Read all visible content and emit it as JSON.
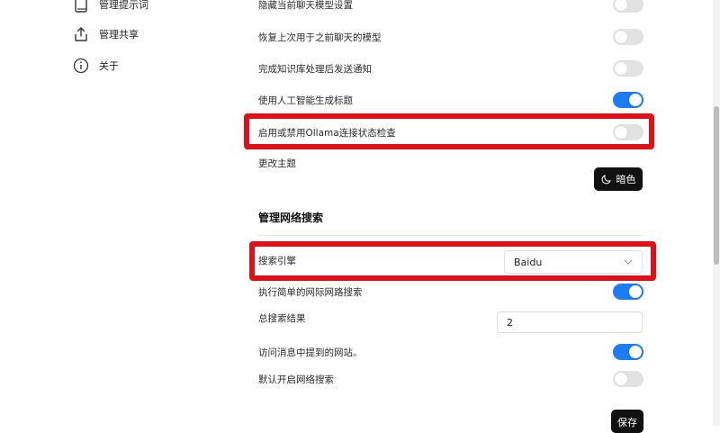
{
  "sidebar": {
    "items": [
      {
        "label": "管理提示词",
        "icon": "book-icon"
      },
      {
        "label": "管理共享",
        "icon": "share-icon"
      },
      {
        "label": "关于",
        "icon": "info-icon"
      }
    ]
  },
  "settings": {
    "hide_model_settings": {
      "label": "隐藏当前聊天模型设置",
      "enabled": false
    },
    "restore_last_model": {
      "label": "恢复上次用于之前聊天的模型",
      "enabled": false
    },
    "kb_notify": {
      "label": "完成知识库处理后发送通知",
      "enabled": false
    },
    "ai_title": {
      "label": "使用人工智能生成标题",
      "enabled": true
    },
    "ollama_check": {
      "label": "启用或禁用Ollama连接状态检查",
      "enabled": false
    },
    "theme": {
      "label": "更改主题",
      "button_label": "暗色",
      "icon": "moon-icon"
    }
  },
  "web_search": {
    "section_title": "管理网络搜索",
    "engine": {
      "label": "搜索引擎",
      "value": "Baidu"
    },
    "simple_search": {
      "label": "执行简单的网际网路搜索",
      "enabled": true
    },
    "total_results": {
      "label": "总搜索结果",
      "value": "2"
    },
    "visit_sites": {
      "label": "访问消息中提到的网站。",
      "enabled": true
    },
    "default_on": {
      "label": "默认开启网络搜索",
      "enabled": false
    }
  },
  "save_label": "保存",
  "colors": {
    "toggle_on": "#1d7bf3",
    "toggle_off": "#e2e2e2",
    "highlight": "#e0101a",
    "button_bg": "#111111"
  }
}
